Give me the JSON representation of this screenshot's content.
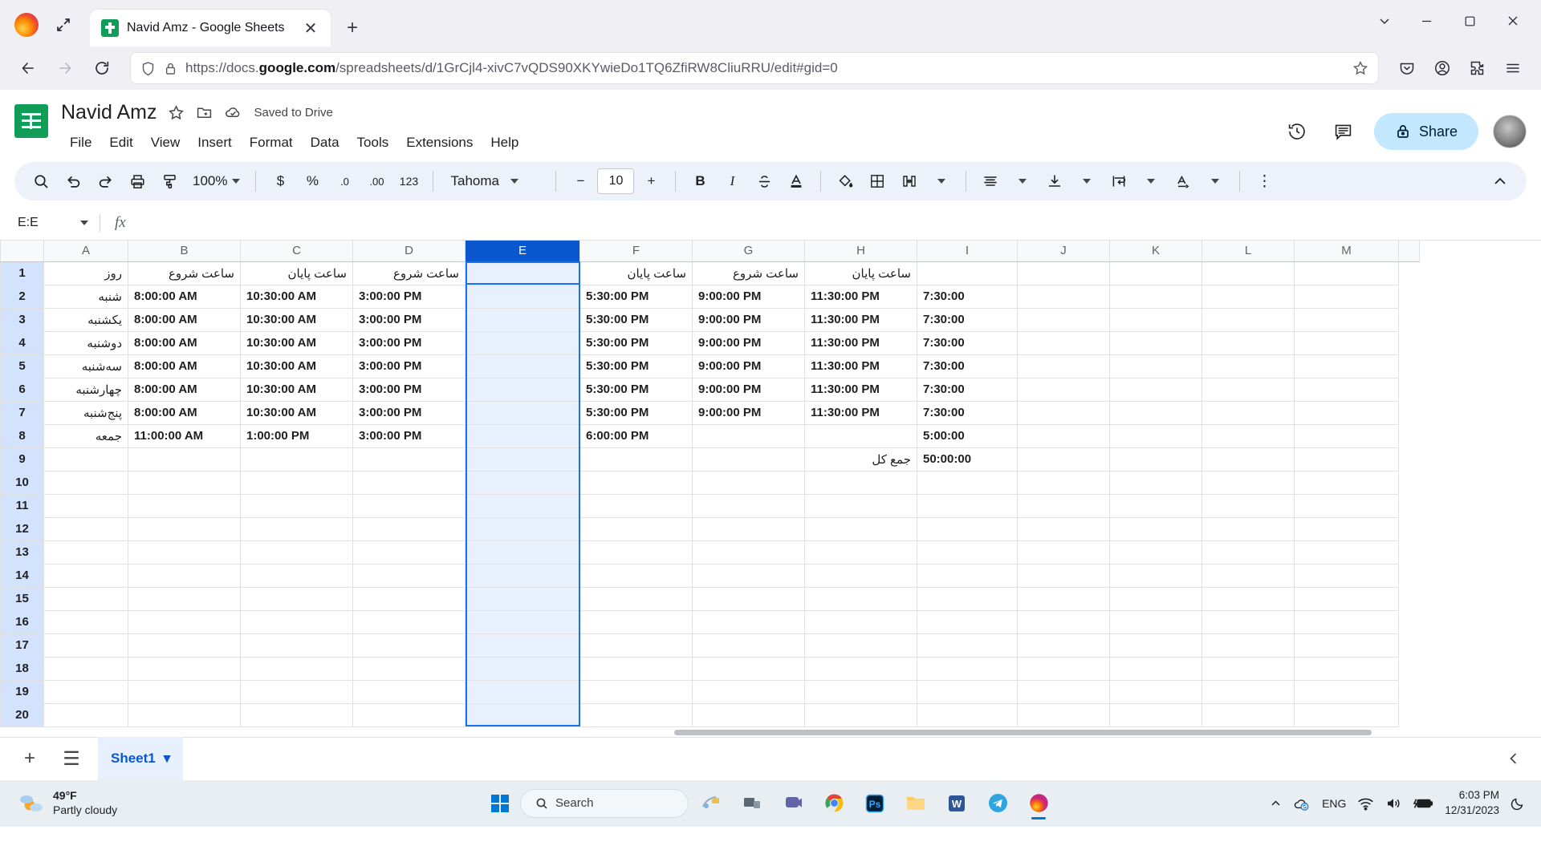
{
  "browser": {
    "tab": {
      "title": "Navid Amz - Google Sheets",
      "favicon": "sheets-icon",
      "close": "✕"
    },
    "new_tab": "+",
    "window_controls": {
      "chevron": "⌄",
      "minimize": "─",
      "maximize": "❐",
      "close": "✕"
    },
    "url": {
      "prefix": "https://docs.",
      "domain": "google.com",
      "suffix": "/spreadsheets/d/1GrCjl4-xivC7vQDS90XKYwieDo1TQ6ZfiRW8CliuRRU/edit#gid=0"
    }
  },
  "sheets": {
    "title": "Navid Amz",
    "save_status": "Saved to Drive",
    "menu": [
      "File",
      "Edit",
      "View",
      "Insert",
      "Format",
      "Data",
      "Tools",
      "Extensions",
      "Help"
    ],
    "share_label": "Share",
    "toolbar": {
      "zoom": "100%",
      "number_123": "123",
      "currency": "$",
      "percent": "%",
      "decimal_dec": ".0",
      "decimal_inc": ".00",
      "font": "Tahoma",
      "font_size": "10",
      "bold": "B",
      "italic": "I",
      "strikethrough": "S",
      "text_color": "A",
      "minus": "−",
      "plus": "+",
      "more": "⋮"
    },
    "name_box": "E:E",
    "formula_value": "",
    "columns": [
      "M",
      "L",
      "K",
      "J",
      "I",
      "H",
      "G",
      "F",
      "E",
      "D",
      "C",
      "B",
      "A"
    ],
    "selected_column": "E",
    "rows": [
      "1",
      "2",
      "3",
      "4",
      "5",
      "6",
      "7",
      "8",
      "9",
      "10",
      "11",
      "12",
      "13",
      "14",
      "15",
      "16",
      "17",
      "18",
      "19",
      "20"
    ],
    "selected_rows": [
      "1",
      "2",
      "3",
      "4",
      "5",
      "6",
      "7",
      "8",
      "9",
      "10",
      "11",
      "12",
      "13",
      "14",
      "15",
      "16",
      "17",
      "18",
      "19",
      "20"
    ],
    "grid": [
      {
        "M": "",
        "L": "",
        "K": "",
        "J": "",
        "I": "",
        "H": "ساعت پایان",
        "G": "ساعت شروع",
        "F": "ساعت پایان",
        "E": "",
        "D": "ساعت شروع",
        "C": "ساعت پایان",
        "B": "ساعت شروع",
        "A": "روز"
      },
      {
        "M": "",
        "L": "",
        "K": "",
        "J": "",
        "I": "7:30:00",
        "H": "11:30:00 PM",
        "G": "9:00:00 PM",
        "F": "5:30:00 PM",
        "E": "",
        "D": "3:00:00 PM",
        "C": "10:30:00 AM",
        "B": "8:00:00 AM",
        "A": "شنبه"
      },
      {
        "M": "",
        "L": "",
        "K": "",
        "J": "",
        "I": "7:30:00",
        "H": "11:30:00 PM",
        "G": "9:00:00 PM",
        "F": "5:30:00 PM",
        "E": "",
        "D": "3:00:00 PM",
        "C": "10:30:00 AM",
        "B": "8:00:00 AM",
        "A": "یکشنبه"
      },
      {
        "M": "",
        "L": "",
        "K": "",
        "J": "",
        "I": "7:30:00",
        "H": "11:30:00 PM",
        "G": "9:00:00 PM",
        "F": "5:30:00 PM",
        "E": "",
        "D": "3:00:00 PM",
        "C": "10:30:00 AM",
        "B": "8:00:00 AM",
        "A": "دوشنبه"
      },
      {
        "M": "",
        "L": "",
        "K": "",
        "J": "",
        "I": "7:30:00",
        "H": "11:30:00 PM",
        "G": "9:00:00 PM",
        "F": "5:30:00 PM",
        "E": "",
        "D": "3:00:00 PM",
        "C": "10:30:00 AM",
        "B": "8:00:00 AM",
        "A": "سه‌شنبه"
      },
      {
        "M": "",
        "L": "",
        "K": "",
        "J": "",
        "I": "7:30:00",
        "H": "11:30:00 PM",
        "G": "9:00:00 PM",
        "F": "5:30:00 PM",
        "E": "",
        "D": "3:00:00 PM",
        "C": "10:30:00 AM",
        "B": "8:00:00 AM",
        "A": "چهارشنبه"
      },
      {
        "M": "",
        "L": "",
        "K": "",
        "J": "",
        "I": "7:30:00",
        "H": "11:30:00 PM",
        "G": "9:00:00 PM",
        "F": "5:30:00 PM",
        "E": "",
        "D": "3:00:00 PM",
        "C": "10:30:00 AM",
        "B": "8:00:00 AM",
        "A": "پنج‌شنبه"
      },
      {
        "M": "",
        "L": "",
        "K": "",
        "J": "",
        "I": "5:00:00",
        "H": "",
        "G": "",
        "F": "6:00:00 PM",
        "E": "",
        "D": "3:00:00 PM",
        "C": "1:00:00 PM",
        "B": "11:00:00 AM",
        "A": "جمعه"
      },
      {
        "M": "",
        "L": "",
        "K": "",
        "J": "",
        "I": "50:00:00",
        "H": "جمع کل",
        "G": "",
        "F": "",
        "E": "",
        "D": "",
        "C": "",
        "B": "",
        "A": ""
      },
      {
        "M": "",
        "L": "",
        "K": "",
        "J": "",
        "I": "",
        "H": "",
        "G": "",
        "F": "",
        "E": "",
        "D": "",
        "C": "",
        "B": "",
        "A": ""
      },
      {
        "M": "",
        "L": "",
        "K": "",
        "J": "",
        "I": "",
        "H": "",
        "G": "",
        "F": "",
        "E": "",
        "D": "",
        "C": "",
        "B": "",
        "A": ""
      },
      {
        "M": "",
        "L": "",
        "K": "",
        "J": "",
        "I": "",
        "H": "",
        "G": "",
        "F": "",
        "E": "",
        "D": "",
        "C": "",
        "B": "",
        "A": ""
      },
      {
        "M": "",
        "L": "",
        "K": "",
        "J": "",
        "I": "",
        "H": "",
        "G": "",
        "F": "",
        "E": "",
        "D": "",
        "C": "",
        "B": "",
        "A": ""
      },
      {
        "M": "",
        "L": "",
        "K": "",
        "J": "",
        "I": "",
        "H": "",
        "G": "",
        "F": "",
        "E": "",
        "D": "",
        "C": "",
        "B": "",
        "A": ""
      },
      {
        "M": "",
        "L": "",
        "K": "",
        "J": "",
        "I": "",
        "H": "",
        "G": "",
        "F": "",
        "E": "",
        "D": "",
        "C": "",
        "B": "",
        "A": ""
      },
      {
        "M": "",
        "L": "",
        "K": "",
        "J": "",
        "I": "",
        "H": "",
        "G": "",
        "F": "",
        "E": "",
        "D": "",
        "C": "",
        "B": "",
        "A": ""
      },
      {
        "M": "",
        "L": "",
        "K": "",
        "J": "",
        "I": "",
        "H": "",
        "G": "",
        "F": "",
        "E": "",
        "D": "",
        "C": "",
        "B": "",
        "A": ""
      },
      {
        "M": "",
        "L": "",
        "K": "",
        "J": "",
        "I": "",
        "H": "",
        "G": "",
        "F": "",
        "E": "",
        "D": "",
        "C": "",
        "B": "",
        "A": ""
      },
      {
        "M": "",
        "L": "",
        "K": "",
        "J": "",
        "I": "",
        "H": "",
        "G": "",
        "F": "",
        "E": "",
        "D": "",
        "C": "",
        "B": "",
        "A": ""
      },
      {
        "M": "",
        "L": "",
        "K": "",
        "J": "",
        "I": "",
        "H": "",
        "G": "",
        "F": "",
        "E": "",
        "D": "",
        "C": "",
        "B": "",
        "A": ""
      }
    ],
    "sheet_tab": {
      "name": "Sheet1",
      "add": "+",
      "all_sheets": "☰",
      "dropdown": "▾"
    }
  },
  "taskbar": {
    "weather": {
      "temp": "49°F",
      "condition": "Partly cloudy"
    },
    "search_placeholder": "Search",
    "language": "ENG",
    "time": "6:03 PM",
    "date": "12/31/2023",
    "apps": [
      "start-button",
      "search",
      "widgets",
      "task-view",
      "teams-icon",
      "chrome-icon",
      "photoshop-icon",
      "file-explorer-icon",
      "word-icon",
      "telegram-icon",
      "firefox-icon"
    ]
  },
  "colors": {
    "accent": "#0b57d0",
    "sheets_green": "#0f9d58",
    "selection_fill": "#e8f0fe",
    "toolbar_bg": "#edf2fa",
    "share_bg": "#c2e7ff"
  }
}
